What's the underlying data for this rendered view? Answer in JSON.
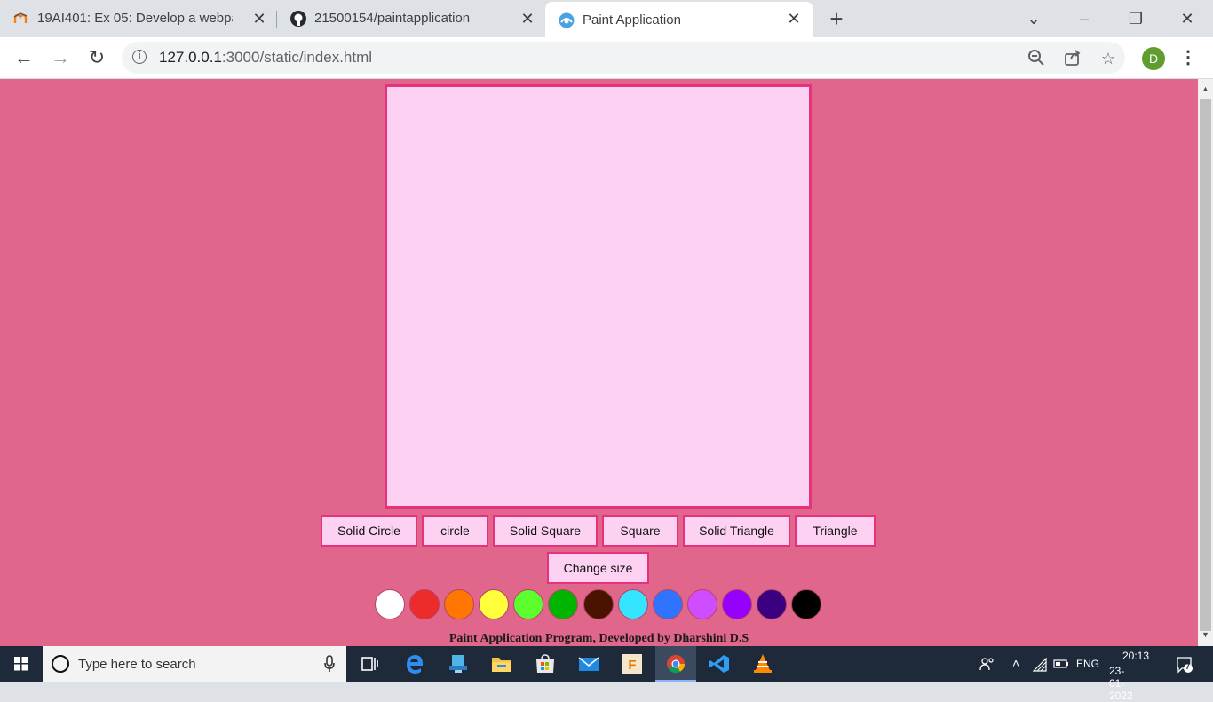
{
  "browser": {
    "tabs": [
      {
        "title": "19AI401: Ex 05: Develop a webpa",
        "icon": "moodle-icon"
      },
      {
        "title": "21500154/paintapplication",
        "icon": "github-icon"
      },
      {
        "title": "Paint Application",
        "icon": "page-favicon",
        "active": true
      }
    ],
    "url_host": "127.0.0.1",
    "url_rest": ":3000/static/index.html",
    "profile_initial": "D"
  },
  "page": {
    "buttons": [
      "Solid Circle",
      "circle",
      "Solid Square",
      "Square",
      "Solid Triangle",
      "Triangle"
    ],
    "size_button": "Change size",
    "colors": [
      "#ffffff",
      "#ee2b2b",
      "#ff7700",
      "#ffff3c",
      "#5cff2c",
      "#00b400",
      "#4a1300",
      "#35e4ff",
      "#2f73ff",
      "#d04cff",
      "#9600ff",
      "#3a0080",
      "#000000"
    ],
    "footer": "Paint Application Program, Developed by Dharshini D.S",
    "background_color": "#e0678b",
    "canvas_color": "#fcd1f2",
    "border_color": "#e8317c"
  },
  "taskbar": {
    "search_placeholder": "Type here to search",
    "language": "ENG",
    "time": "20:13",
    "date": "23-01-2022",
    "notifications": "7"
  }
}
